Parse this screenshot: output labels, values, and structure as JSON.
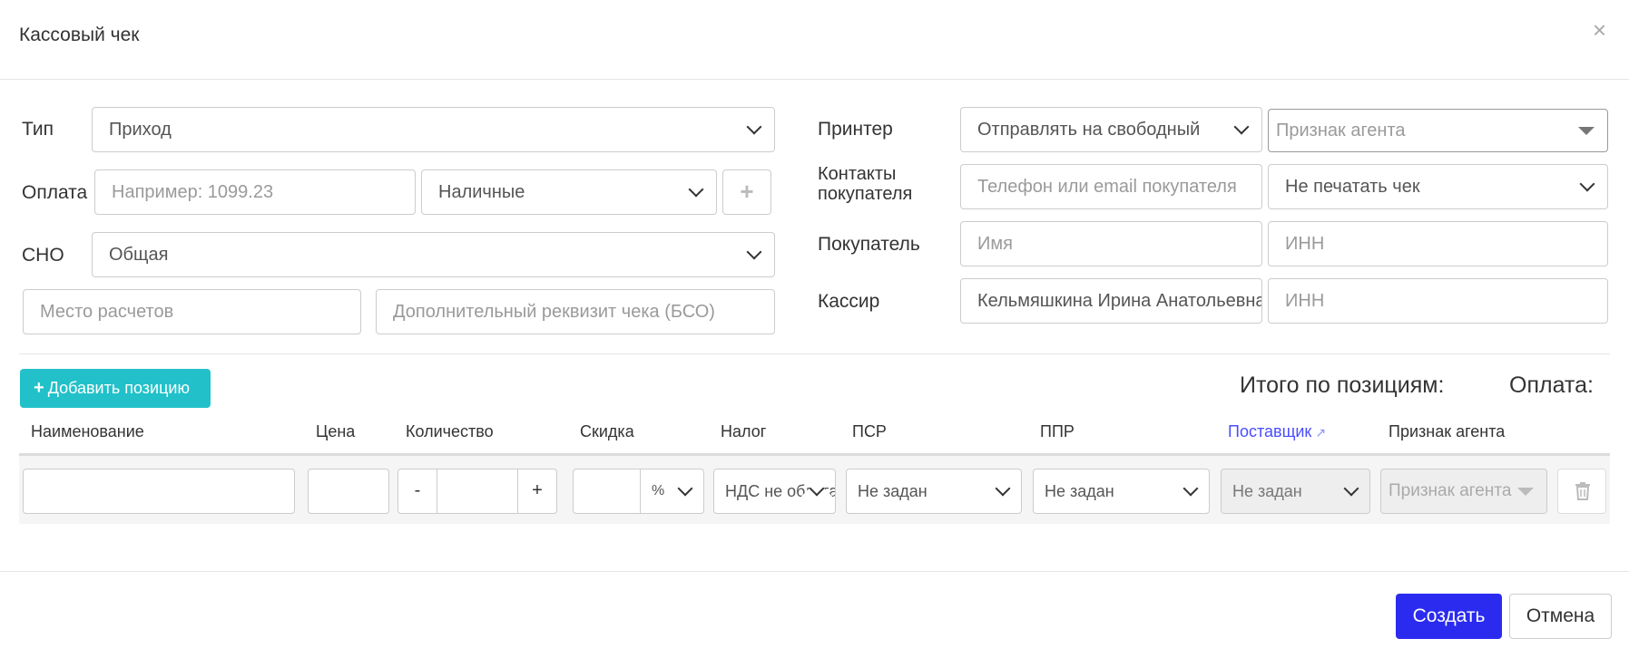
{
  "dialog": {
    "title": "Кассовый чек",
    "close_icon": "×"
  },
  "left": {
    "type_label": "Тип",
    "type_value": "Приход",
    "payment_label": "Оплата",
    "payment_amount_placeholder": "Например: 1099.23",
    "payment_method_value": "Наличные",
    "add_payment_icon": "+",
    "sno_label": "СНО",
    "sno_value": "Общая",
    "place_placeholder": "Место расчетов",
    "extra_placeholder": "Дополнительный реквизит чека (БСО)"
  },
  "right": {
    "printer_label": "Принтер",
    "printer_value": "Отправлять на свободный",
    "agent_placeholder": "Признак агента",
    "contacts_label_line1": "Контакты",
    "contacts_label_line2": "покупателя",
    "contacts_placeholder": "Телефон или email покупателя",
    "print_value": "Не печатать чек",
    "buyer_label": "Покупатель",
    "buyer_name_placeholder": "Имя",
    "buyer_inn_placeholder": "ИНН",
    "cashier_label": "Кассир",
    "cashier_value": "Кельмяшкина Ирина Анатольевна",
    "cashier_inn_placeholder": "ИНН"
  },
  "positions": {
    "add_label": "Добавить позицию",
    "total_label": "Итого по позициям:",
    "payment_total_label": "Оплата:",
    "headers": {
      "name": "Наименование",
      "price": "Цена",
      "qty": "Количество",
      "discount": "Скидка",
      "tax": "Налог",
      "psr": "ПСР",
      "ppr": "ППР",
      "supplier": "Поставщик",
      "agent": "Признак агента"
    },
    "row": {
      "minus": "-",
      "plus": "+",
      "discount_unit": "%",
      "tax_value": "НДС не облагается",
      "psr_value": "Не задан",
      "ppr_value": "Не задан",
      "supplier_value": "Не задан",
      "agent_placeholder": "Признак агента"
    }
  },
  "footer": {
    "create_label": "Создать",
    "cancel_label": "Отмена"
  },
  "colors": {
    "accent": "#22c1c9",
    "primary": "#2b2bf0",
    "link": "#4a4dff"
  }
}
